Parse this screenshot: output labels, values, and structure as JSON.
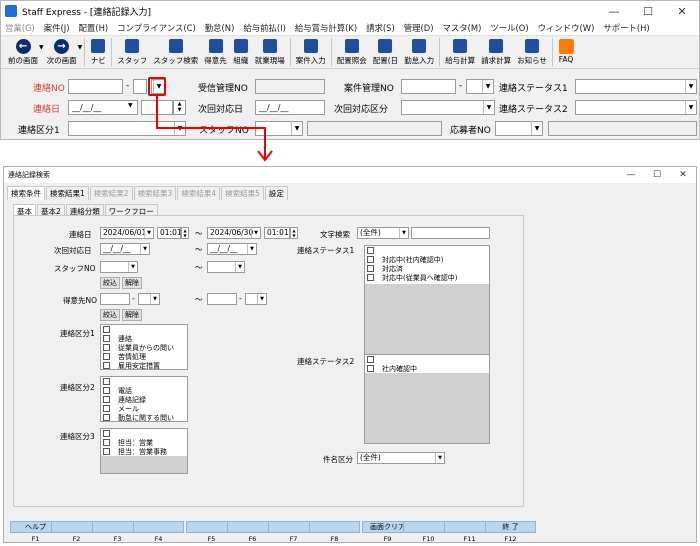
{
  "main_window": {
    "title": "Staff Express - [連絡記録入力]",
    "controls": [
      "—",
      "☐",
      "✕"
    ],
    "menu": [
      {
        "label": "営業(G)",
        "disabled": true
      },
      {
        "label": "案件(J)"
      },
      {
        "label": "配置(H)"
      },
      {
        "label": "コンプライアンス(C)"
      },
      {
        "label": "勤怠(N)"
      },
      {
        "label": "給与前払(I)"
      },
      {
        "label": "給与賞与計算(K)"
      },
      {
        "label": "請求(S)"
      },
      {
        "label": "管理(D)"
      },
      {
        "label": "マスタ(M)"
      },
      {
        "label": "ツール(O)"
      },
      {
        "label": "ウィンドウ(W)"
      },
      {
        "label": "サポート(H)"
      }
    ],
    "toolbar": {
      "prev": "前の画面",
      "next": "次の画面",
      "navi": "ナビ",
      "staff": "スタッフ",
      "staff_search": "スタッフ検索",
      "client": "得意先",
      "org": "組織",
      "site": "就業現場",
      "job_entry": "案件入力",
      "assign_ref": "配置照会",
      "assign_day": "配置(日",
      "attendance": "勤怠入力",
      "payroll": "給与計算",
      "billing": "請求計算",
      "notice": "お知らせ",
      "faq": "FAQ"
    },
    "form": {
      "contact_no_label": "連絡NO",
      "contact_no_sep": "-",
      "received_no_label": "受信管理NO",
      "case_no_label": "案件管理NO",
      "case_no_sep": "-",
      "status1_label": "連絡ステータス1",
      "contact_date_label": "連絡日",
      "contact_date_value": "__/__/__",
      "next_date_label": "次回対応日",
      "next_date_value": "__/__/__",
      "next_type_label": "次回対応区分",
      "status2_label": "連絡ステータス2",
      "category1_label": "連絡区分1",
      "staff_no_label": "スタッフNO",
      "applicant_no_label": "応募者NO"
    }
  },
  "search_window": {
    "title": "連絡記録検索",
    "controls": [
      "—",
      "☐",
      "✕"
    ],
    "tabs": [
      {
        "label": "検索条件",
        "active": true
      },
      {
        "label": "検索結果1"
      },
      {
        "label": "検索結果2",
        "disabled": true
      },
      {
        "label": "検索結果3",
        "disabled": true
      },
      {
        "label": "検索結果4",
        "disabled": true
      },
      {
        "label": "検索結果5",
        "disabled": true
      },
      {
        "label": "設定"
      }
    ],
    "subtabs": [
      {
        "label": "基本",
        "active": true
      },
      {
        "label": "基本2"
      },
      {
        "label": "連絡分類"
      },
      {
        "label": "ワークフロー"
      }
    ],
    "fields": {
      "contact_date_label": "連絡日",
      "date_from": "2024/06/01",
      "time_from": "01:01",
      "tilde": "～",
      "date_to": "2024/06/30",
      "time_to": "01:01",
      "next_date_label": "次回対応日",
      "next_from": "__/__/__",
      "next_to": "__/__/__",
      "staff_no_label": "スタッフNO",
      "narrow_label": "絞込",
      "clear_label": "解除",
      "client_no_label": "得意先NO",
      "client_sep": "-",
      "text_search_label": "文字検索",
      "text_search_value": "(全件)",
      "status1_label": "連絡ステータス1",
      "status2_label": "連絡ステータス2",
      "category1_label": "連絡区分1",
      "category2_label": "連絡区分2",
      "category3_label": "連絡区分3",
      "subject_label": "件名区分",
      "subject_value": "(全件)"
    },
    "status1_items": [
      "",
      "対応中(社内確認中)",
      "対応済",
      "対応中(従業員へ確認中)"
    ],
    "status2_items": [
      "",
      "社内確認中"
    ],
    "category1_items": [
      "",
      "連絡",
      "従業員からの問い",
      "苦情処理",
      "雇用安定措置"
    ],
    "category2_items": [
      "",
      "電話",
      "連絡記録",
      "メール",
      "勤怠に関する問い"
    ],
    "category3_items": [
      "",
      "担当：営業",
      "担当：営業事務"
    ],
    "fkeys": [
      {
        "label": "ヘルプ",
        "key": "F1"
      },
      {
        "label": "",
        "key": "F2"
      },
      {
        "label": "",
        "key": "F3"
      },
      {
        "label": "",
        "key": "F4"
      },
      {
        "label": "",
        "key": "F5"
      },
      {
        "label": "",
        "key": "F6"
      },
      {
        "label": "",
        "key": "F7"
      },
      {
        "label": "",
        "key": "F8"
      },
      {
        "label": "画面クリア",
        "key": "F9"
      },
      {
        "label": "",
        "key": "F10"
      },
      {
        "label": "",
        "key": "F11"
      },
      {
        "label": "終 了",
        "key": "F12"
      }
    ]
  }
}
